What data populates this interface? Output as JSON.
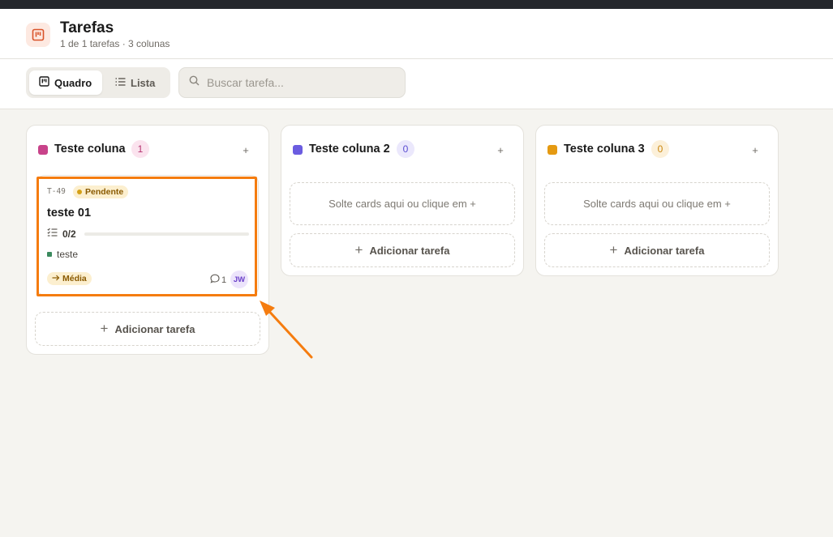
{
  "header": {
    "title": "Tarefas",
    "subtitle": "1 de 1 tarefas · 3 colunas",
    "app_icon": "kanban-board-icon"
  },
  "view_toggle": {
    "board_label": "Quadro",
    "board_icon": "board-icon",
    "list_label": "Lista",
    "list_icon": "list-icon",
    "selected": "Quadro"
  },
  "search": {
    "placeholder": "Buscar tarefa...",
    "value": ""
  },
  "columns": [
    {
      "title": "Teste coluna",
      "count": "1",
      "color": "#c8438a",
      "count_bg": "#fbe3ee",
      "count_color": "#b3336f",
      "add_label": "+",
      "add_task_label": "Adicionar tarefa",
      "cards": [
        {
          "id": "T-49",
          "status": "Pendente",
          "title": "teste 01",
          "checklist": "0/2",
          "checklist_progress": 0,
          "tag": "teste",
          "priority": "Média",
          "comments": "1",
          "assignee_initials": "JW"
        }
      ]
    },
    {
      "title": "Teste coluna 2",
      "count": "0",
      "color": "#6b5ce0",
      "count_bg": "#ebe8fc",
      "count_color": "#5a4cd1",
      "add_label": "+",
      "dropzone_text": "Solte cards aqui ou clique em +",
      "add_task_label": "Adicionar tarefa"
    },
    {
      "title": "Teste coluna 3",
      "count": "0",
      "color": "#e59a12",
      "count_bg": "#fcf0d9",
      "count_color": "#c9860d",
      "add_label": "+",
      "dropzone_text": "Solte cards aqui ou clique em +",
      "add_task_label": "Adicionar tarefa"
    }
  ],
  "annotation": {
    "highlight_color": "#f57c0f"
  }
}
